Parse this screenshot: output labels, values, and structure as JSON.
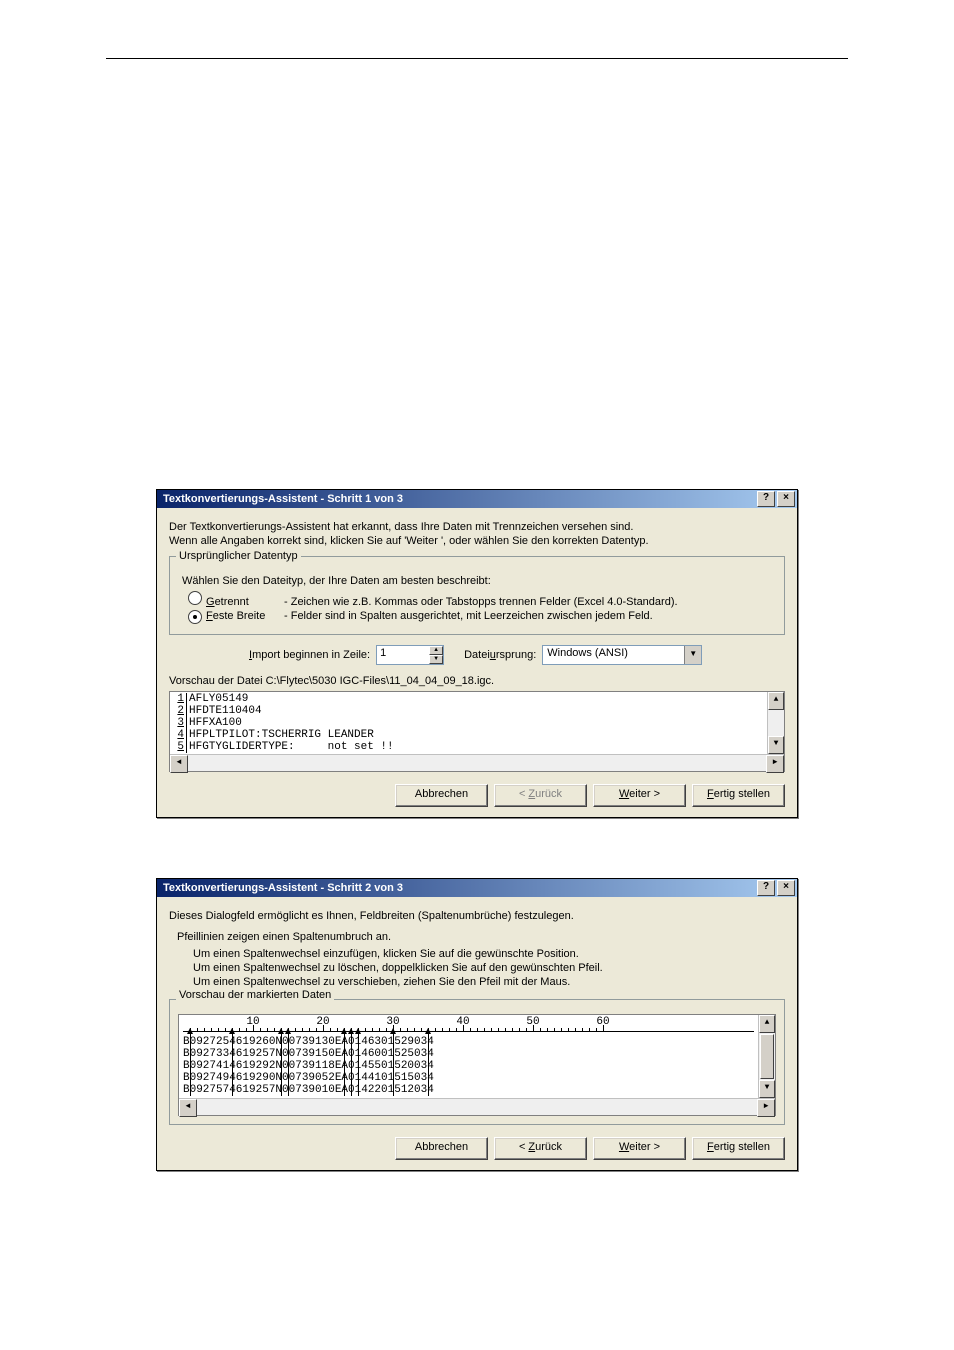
{
  "dialog1": {
    "title": "Textkonvertierungs-Assistent - Schritt 1 von 3",
    "intro_line1": "Der Textkonvertierungs-Assistent hat erkannt, dass Ihre Daten mit Trennzeichen versehen sind.",
    "intro_line2": "Wenn alle Angaben korrekt sind, klicken Sie auf 'Weiter ', oder wählen Sie den korrekten Datentyp.",
    "group_legend": "Ursprünglicher Datentyp",
    "choose_label": "Wählen Sie den Dateityp, der Ihre Daten am besten beschreibt:",
    "radio1_label_pre": "G",
    "radio1_label_rest": "etrennt",
    "radio1_desc": "- Zeichen wie z.B. Kommas oder Tabstopps trennen Felder (Excel 4.0-Standard).",
    "radio2_label_pre": "F",
    "radio2_label_rest": "este Breite",
    "radio2_desc": "- Felder sind in Spalten ausgerichtet, mit Leerzeichen zwischen jedem Feld.",
    "start_row_label": "Import beginnen in Zeile:",
    "start_row_value": "1",
    "origin_label": "Dateiursprung:",
    "origin_value": "Windows (ANSI)",
    "preview_label": "Vorschau der Datei C:\\Flytec\\5030 IGC-Files\\11_04_04_09_18.igc.",
    "preview_lines": [
      {
        "n": "1",
        "t": "AFLY05149"
      },
      {
        "n": "2",
        "t": "HFDTE110404"
      },
      {
        "n": "3",
        "t": "HFFXA100"
      },
      {
        "n": "4",
        "t": "HFPLTPILOT:TSCHERRIG LEANDER"
      },
      {
        "n": "5",
        "t": "HFGTYGLIDERTYPE:     not set !!"
      }
    ]
  },
  "dialog2": {
    "title": "Textkonvertierungs-Assistent - Schritt 2 von 3",
    "intro": "Dieses Dialogfeld ermöglicht es Ihnen, Feldbreiten (Spaltenumbrüche) festzulegen.",
    "line_hint": "Pfeillinien zeigen einen Spaltenumbruch an.",
    "inst1": "Um einen Spaltenwechsel einzufügen, klicken Sie auf die gewünschte Position.",
    "inst2": "Um einen Spaltenwechsel zu löschen, doppelklicken Sie auf den gewünschten Pfeil.",
    "inst3": "Um einen Spaltenwechsel zu verschieben, ziehen Sie den Pfeil mit der Maus.",
    "group_legend": "Vorschau der markierten Daten",
    "ruler_marks": [
      "10",
      "20",
      "30",
      "40",
      "50",
      "60"
    ],
    "rows": [
      "B0927254619260N00739130EA0146301529034",
      "B0927334619257N00739150EA0146001525034",
      "B0927414619292N00739118EA0145501520034",
      "B0927494619290N00739052EA0144101515034",
      "B0927574619257N00739010EA0142201512034"
    ]
  },
  "buttons": {
    "cancel": "Abbrechen",
    "back": "< Zurück",
    "next": "Weiter >",
    "finish": "Fertig stellen"
  },
  "chart_data": {
    "type": "table",
    "title": "IGC file fixed-width preview — column break positions",
    "column_breaks": [
      1,
      7,
      14,
      15,
      23,
      24,
      25,
      30,
      35
    ],
    "rows": [
      "B0927254619260N00739130EA0146301529034",
      "B0927334619257N00739150EA0146001525034",
      "B0927414619292N00739118EA0145501520034",
      "B0927494619290N00739052EA0144101515034",
      "B0927574619257N00739010EA0142201512034"
    ],
    "ruler_max": 60
  }
}
